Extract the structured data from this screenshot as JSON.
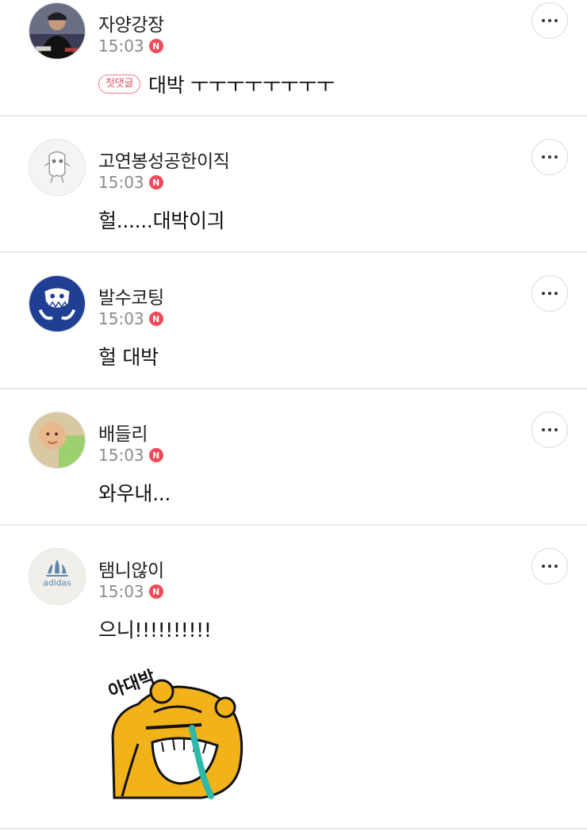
{
  "comments": [
    {
      "user": "자양강장",
      "time": "15:03",
      "badge": "N",
      "first_badge": "첫댓글",
      "text": "대박 ㅜㅜㅜㅜㅜㅜㅜㅜ",
      "avatar_icon": "person-photo"
    },
    {
      "user": "고연봉성공한이직",
      "time": "15:03",
      "badge": "N",
      "text": "헐......대박이긔",
      "avatar_icon": "cartoon-character"
    },
    {
      "user": "발수코팅",
      "time": "15:03",
      "badge": "N",
      "text": "헐 대박",
      "avatar_icon": "blue-monster-logo"
    },
    {
      "user": "배들리",
      "time": "15:03",
      "badge": "N",
      "text": "와우내...",
      "avatar_icon": "baby-photo"
    },
    {
      "user": "탬니않이",
      "time": "15:03",
      "badge": "N",
      "text": "으니!!!!!!!!!!",
      "avatar_icon": "adidas-logo",
      "avatar_logo_text": "adidas",
      "sticker_text": "아대박",
      "sticker_icon": "crying-laughing-bear-sticker"
    }
  ],
  "colors": {
    "badge": "#f04a58",
    "divider": "#e9e9e9",
    "adidas_blue": "#5a86ad",
    "sticker_yellow": "#f2b21a"
  }
}
